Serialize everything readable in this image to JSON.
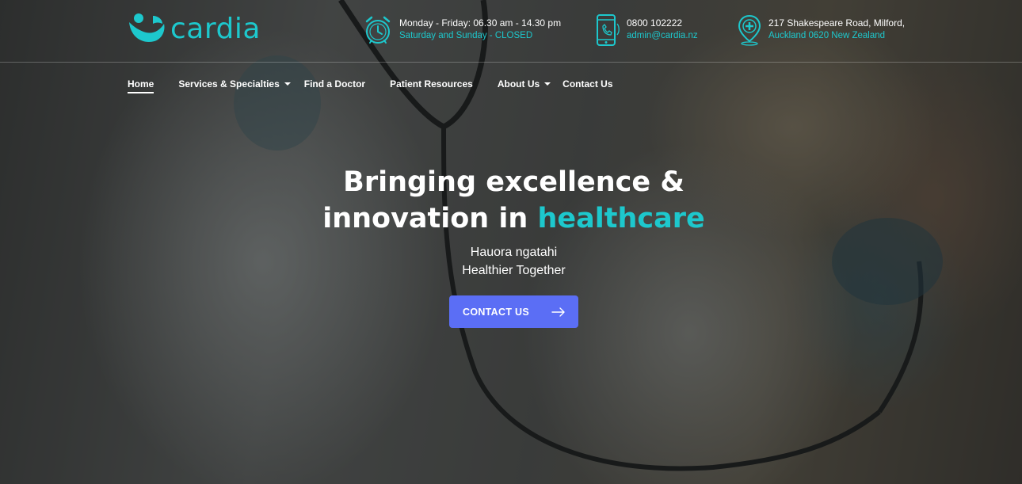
{
  "brand": {
    "name": "cardia",
    "accent_color": "#1dc8cd",
    "button_color": "#5b6ef5",
    "logo_icon": "smile-figure-icon"
  },
  "header": {
    "hours": {
      "icon": "alarm-clock-icon",
      "line1": "Monday - Friday: 06.30 am - 14.30 pm",
      "line2": "Saturday and Sunday - CLOSED"
    },
    "contact": {
      "icon": "phone-icon",
      "phone": "0800 102222",
      "email": "admin@cardia.nz"
    },
    "address": {
      "icon": "map-pin-medical-icon",
      "line1": "217 Shakespeare Road, Milford,",
      "line2": "Auckland 0620 New Zealand"
    }
  },
  "nav": {
    "home": "Home",
    "services": "Services & Specialties",
    "find_doctor": "Find a Doctor",
    "patient_resources": "Patient Resources",
    "about": "About Us",
    "contact": "Contact Us"
  },
  "hero": {
    "headline_line1": "Bringing excellence &",
    "headline_line2_prefix": "innovation in ",
    "headline_accent": "healthcare",
    "sub_line1": "Hauora ngatahi",
    "sub_line2": "Healthier Together",
    "cta_label": "CONTACT US",
    "cta_icon": "arrow-right-icon"
  }
}
